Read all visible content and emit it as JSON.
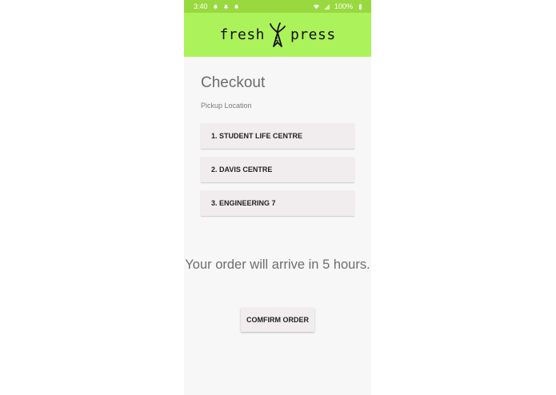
{
  "status_bar": {
    "time": "3:40",
    "battery": "100%",
    "notification_icons": [
      "bell-icon",
      "bell-icon",
      "bell-icon"
    ],
    "status_icons": [
      "wifi-icon",
      "signal-icon",
      "battery-icon"
    ]
  },
  "app_bar": {
    "logo_left": "fresh",
    "logo_right": "press",
    "logo_icon": "carrot-icon",
    "color": "#acf25a"
  },
  "checkout": {
    "title": "Checkout",
    "subtitle": "Pickup Location",
    "locations": [
      "1. STUDENT LIFE CENTRE",
      "2. DAVIS CENTRE",
      "3. ENGINEERING 7"
    ],
    "arrival_message": "Your order will arrive in 5 hours.",
    "confirm_label": "COMFIRM ORDER"
  }
}
